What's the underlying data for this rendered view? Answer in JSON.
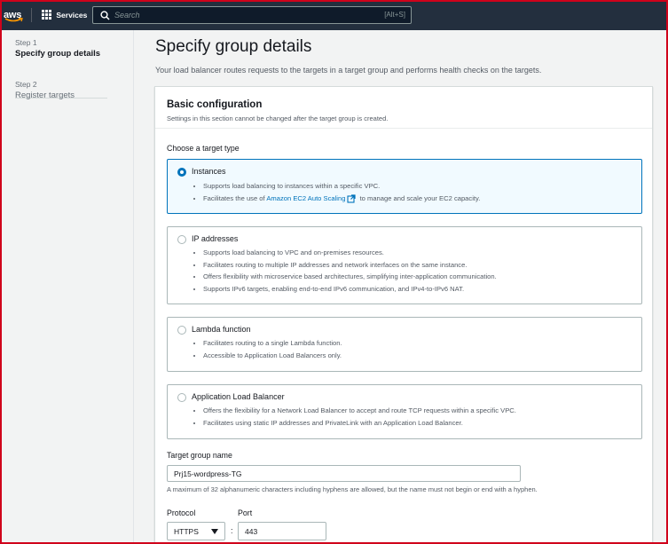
{
  "topnav": {
    "logo_text": "aws",
    "services_label": "Services",
    "search_placeholder": "Search",
    "search_shortcut": "[Alt+S]"
  },
  "sidebar": {
    "steps": [
      {
        "number": "Step 1",
        "title": "Specify group details",
        "active": true
      },
      {
        "number": "Step 2",
        "title": "Register targets",
        "active": false
      }
    ]
  },
  "main": {
    "title": "Specify group details",
    "description": "Your load balancer routes requests to the targets in a target group and performs health checks on the targets."
  },
  "basic_config": {
    "title": "Basic configuration",
    "subtitle": "Settings in this section cannot be changed after the target group is created.",
    "target_type_label": "Choose a target type",
    "options": [
      {
        "title": "Instances",
        "selected": true,
        "bullets": [
          "Supports load balancing to instances within a specific VPC.",
          "Facilitates the use of"
        ],
        "link": "Amazon EC2 Auto Scaling",
        "link_suffix": "to manage and scale your EC2 capacity."
      },
      {
        "title": "IP addresses",
        "selected": false,
        "bullets": [
          "Supports load balancing to VPC and on-premises resources.",
          "Facilitates routing to multiple IP addresses and network interfaces on the same instance.",
          "Offers flexibility with microservice based architectures, simplifying inter-application communication.",
          "Supports IPv6 targets, enabling end-to-end IPv6 communication, and IPv4-to-IPv6 NAT."
        ]
      },
      {
        "title": "Lambda function",
        "selected": false,
        "bullets": [
          "Facilitates routing to a single Lambda function.",
          "Accessible to Application Load Balancers only."
        ]
      },
      {
        "title": "Application Load Balancer",
        "selected": false,
        "bullets": [
          "Offers the flexibility for a Network Load Balancer to accept and route TCP requests within a specific VPC.",
          "Facilitates using static IP addresses and PrivateLink with an Application Load Balancer."
        ]
      }
    ],
    "target_group_name_label": "Target group name",
    "target_group_name_value": "Prj15-wordpress-TG",
    "target_group_name_hint": "A maximum of 32 alphanumeric characters including hyphens are allowed, but the name must not begin or end with a hyphen.",
    "protocol_label": "Protocol",
    "protocol_value": "HTTPS",
    "port_label": "Port",
    "port_value": "443",
    "colon": ":"
  },
  "colors": {
    "nav_bg": "#232f3e",
    "selected_border": "#0073bb",
    "selected_bg": "#f1faff",
    "link": "#0073bb",
    "frame_border": "#d0021b"
  }
}
